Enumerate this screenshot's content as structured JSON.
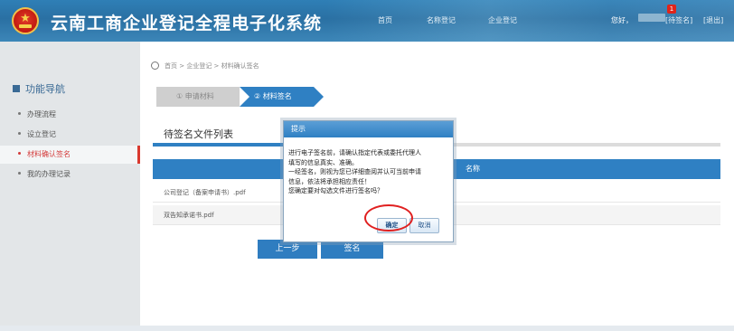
{
  "header": {
    "title": "云南工商企业登记全程电子化系统",
    "nav": [
      "首页",
      "名称登记",
      "企业登记"
    ],
    "greeting": "您好，",
    "pending_label": "[待签名]",
    "pending_count": "1",
    "logout_label": "[退出]",
    "emblem_icon": "national-emblem-icon"
  },
  "sidebar": {
    "heading": "功能导航",
    "items": [
      {
        "label": "办理流程",
        "active": false
      },
      {
        "label": "设立登记",
        "active": false
      },
      {
        "label": "材料确认签名",
        "active": true
      },
      {
        "label": "我的办理记录",
        "active": false
      }
    ]
  },
  "breadcrumb": "首页 > 企业登记 > 材料确认签名",
  "steps": [
    "① 申请材料",
    "② 材料签名"
  ],
  "section": {
    "title": "待签名文件列表",
    "column_name": "名称",
    "files": [
      "公司登记（备案申请书）.pdf",
      "双告知承诺书.pdf"
    ]
  },
  "buttons": {
    "prev": "上一步",
    "sign": "签名"
  },
  "dialog": {
    "title": "提示",
    "lines": [
      "进行电子签名前，请确认指定代表或委托代理人",
      "填写的信息真实、准确。",
      "一经签名，则视为您已详细查阅并认可当前申请",
      "信息，依法将承担相应责任！",
      "您确定要对勾选文件进行签名吗？"
    ],
    "ok": "确定",
    "cancel": "取消"
  },
  "colors": {
    "header_blue": "#2f7fb6",
    "accent_blue": "#2f80c3",
    "active_red": "#d33a3a",
    "annotation_red": "#e02020"
  }
}
